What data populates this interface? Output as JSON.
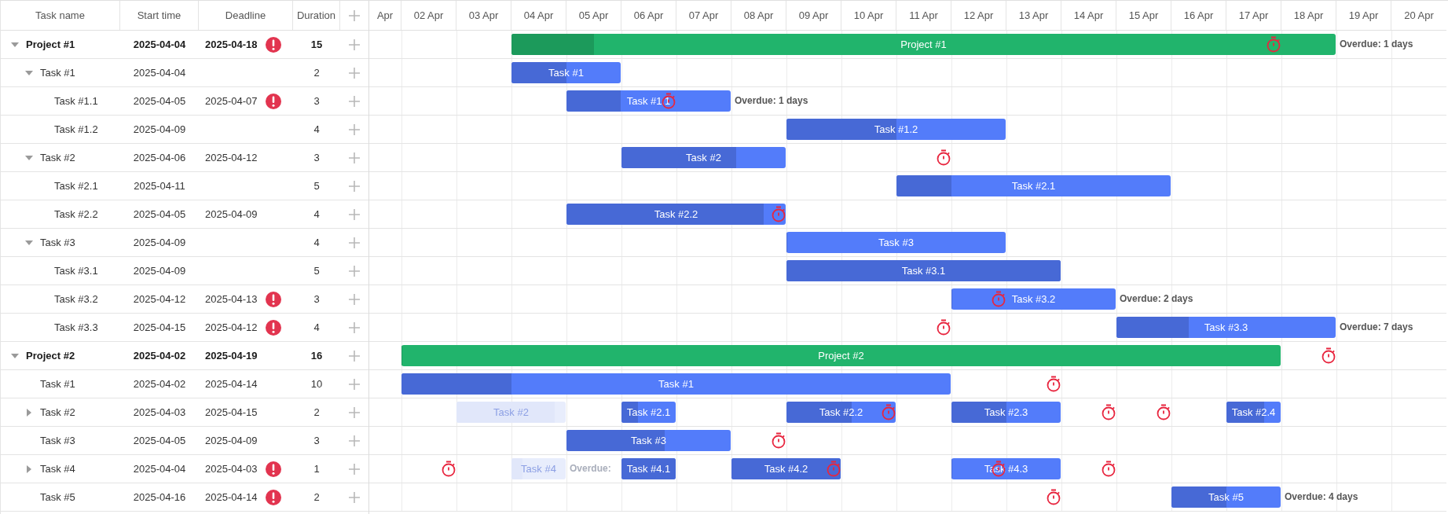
{
  "grid": {
    "columns": [
      "Task name",
      "Start time",
      "Deadline",
      "Duration"
    ]
  },
  "timeline": {
    "days": [
      "Apr",
      "02 Apr",
      "03 Apr",
      "04 Apr",
      "05 Apr",
      "06 Apr",
      "07 Apr",
      "08 Apr",
      "09 Apr",
      "10 Apr",
      "11 Apr",
      "12 Apr",
      "13 Apr",
      "14 Apr",
      "15 Apr",
      "16 Apr",
      "17 Apr",
      "18 Apr",
      "19 Apr",
      "20 Apr"
    ]
  },
  "tasks": [
    {
      "kind": "project",
      "name": "Project #1",
      "start": "2025-04-04",
      "deadline": "2025-04-18",
      "duration": "15",
      "warning": true,
      "bar_label": "Project #1",
      "level": 0.1,
      "overdue": "Overdue: 1 days",
      "expanded": true,
      "children": [
        {
          "kind": "task",
          "name": "Task #1",
          "start": "2025-04-04",
          "duration": "2",
          "warning": false,
          "bar_label": "Task #1",
          "level": 0.5,
          "expanded": true,
          "children": [
            {
              "kind": "task",
              "name": "Task #1.1",
              "start": "2025-04-05",
              "deadline": "2025-04-07",
              "duration": "3",
              "warning": true,
              "bar_label": "Task #1.1",
              "level": 0.33,
              "overdue": "Overdue: 1 days"
            },
            {
              "kind": "task",
              "name": "Task #1.2",
              "start": "2025-04-09",
              "duration": "4",
              "warning": false,
              "bar_label": "Task #1.2",
              "level": 0.5
            }
          ]
        },
        {
          "kind": "task",
          "name": "Task #2",
          "start": "2025-04-06",
          "deadline": "2025-04-12",
          "duration": "3",
          "warning": false,
          "bar_label": "Task #2",
          "level": 0.7,
          "expanded": true,
          "children": [
            {
              "kind": "task",
              "name": "Task #2.1",
              "start": "2025-04-11",
              "duration": "5",
              "warning": false,
              "bar_label": "Task #2.1",
              "level": 0.2
            },
            {
              "kind": "task",
              "name": "Task #2.2",
              "start": "2025-04-05",
              "deadline": "2025-04-09",
              "duration": "4",
              "warning": false,
              "bar_label": "Task #2.2",
              "level": 0.9
            }
          ]
        },
        {
          "kind": "task",
          "name": "Task #3",
          "start": "2025-04-09",
          "duration": "4",
          "warning": false,
          "bar_label": "Task #3",
          "level": 0,
          "expanded": true,
          "children": [
            {
              "kind": "task",
              "name": "Task #3.1",
              "start": "2025-04-09",
              "duration": "5",
              "warning": false,
              "bar_label": "Task #3.1",
              "level": 1
            },
            {
              "kind": "task",
              "name": "Task #3.2",
              "start": "2025-04-12",
              "deadline": "2025-04-13",
              "duration": "3",
              "warning": true,
              "bar_label": "Task #3.2",
              "level": 0,
              "overdue": "Overdue: 2 days"
            },
            {
              "kind": "task",
              "name": "Task #3.3",
              "start": "2025-04-15",
              "deadline": "2025-04-12",
              "duration": "4",
              "warning": true,
              "bar_label": "Task #3.3",
              "level": 0.33,
              "overdue": "Overdue: 7 days"
            }
          ]
        }
      ]
    },
    {
      "kind": "project",
      "name": "Project #2",
      "start": "2025-04-02",
      "deadline": "2025-04-19",
      "duration": "16",
      "warning": false,
      "bar_label": "Project #2",
      "level": 0,
      "expanded": true,
      "children": [
        {
          "kind": "task",
          "name": "Task #1",
          "start": "2025-04-02",
          "deadline": "2025-04-14",
          "duration": "10",
          "warning": false,
          "bar_label": "Task #1",
          "level": 0.2
        },
        {
          "kind": "task",
          "name": "Task #2",
          "start": "2025-04-03",
          "deadline": "2025-04-15",
          "duration": "2",
          "warning": false,
          "bar_label": "Task #2",
          "level": 0.9,
          "expanded": false,
          "children": [
            {
              "kind": "task",
              "bar_label": "Task #2.1",
              "level": 0.3
            },
            {
              "kind": "task",
              "bar_label": "Task #2.2",
              "level": 0.6
            },
            {
              "kind": "task",
              "bar_label": "Task #2.3",
              "level": 0.5
            },
            {
              "kind": "task",
              "bar_label": "Task #2.4",
              "level": 0.7
            }
          ]
        },
        {
          "kind": "task",
          "name": "Task #3",
          "start": "2025-04-05",
          "deadline": "2025-04-09",
          "duration": "3",
          "warning": false,
          "bar_label": "Task #3",
          "level": 0.6
        },
        {
          "kind": "task",
          "name": "Task #4",
          "start": "2025-04-04",
          "deadline": "2025-04-03",
          "duration": "1",
          "warning": true,
          "bar_label": "Task #4",
          "level": 0.2,
          "overdue": "Overdue:",
          "expanded": false,
          "children": [
            {
              "kind": "task",
              "bar_label": "Task #4.1",
              "level": 1
            },
            {
              "kind": "task",
              "bar_label": "Task #4.2",
              "level": 1
            },
            {
              "kind": "task",
              "bar_label": "Task #4.3",
              "level": 0
            }
          ]
        },
        {
          "kind": "task",
          "name": "Task #5",
          "start": "2025-04-16",
          "deadline": "2025-04-14",
          "duration": "2",
          "warning": true,
          "bar_label": "Task #5",
          "level": 0.5,
          "overdue": "Overdue: 4 days"
        }
      ]
    }
  ]
}
